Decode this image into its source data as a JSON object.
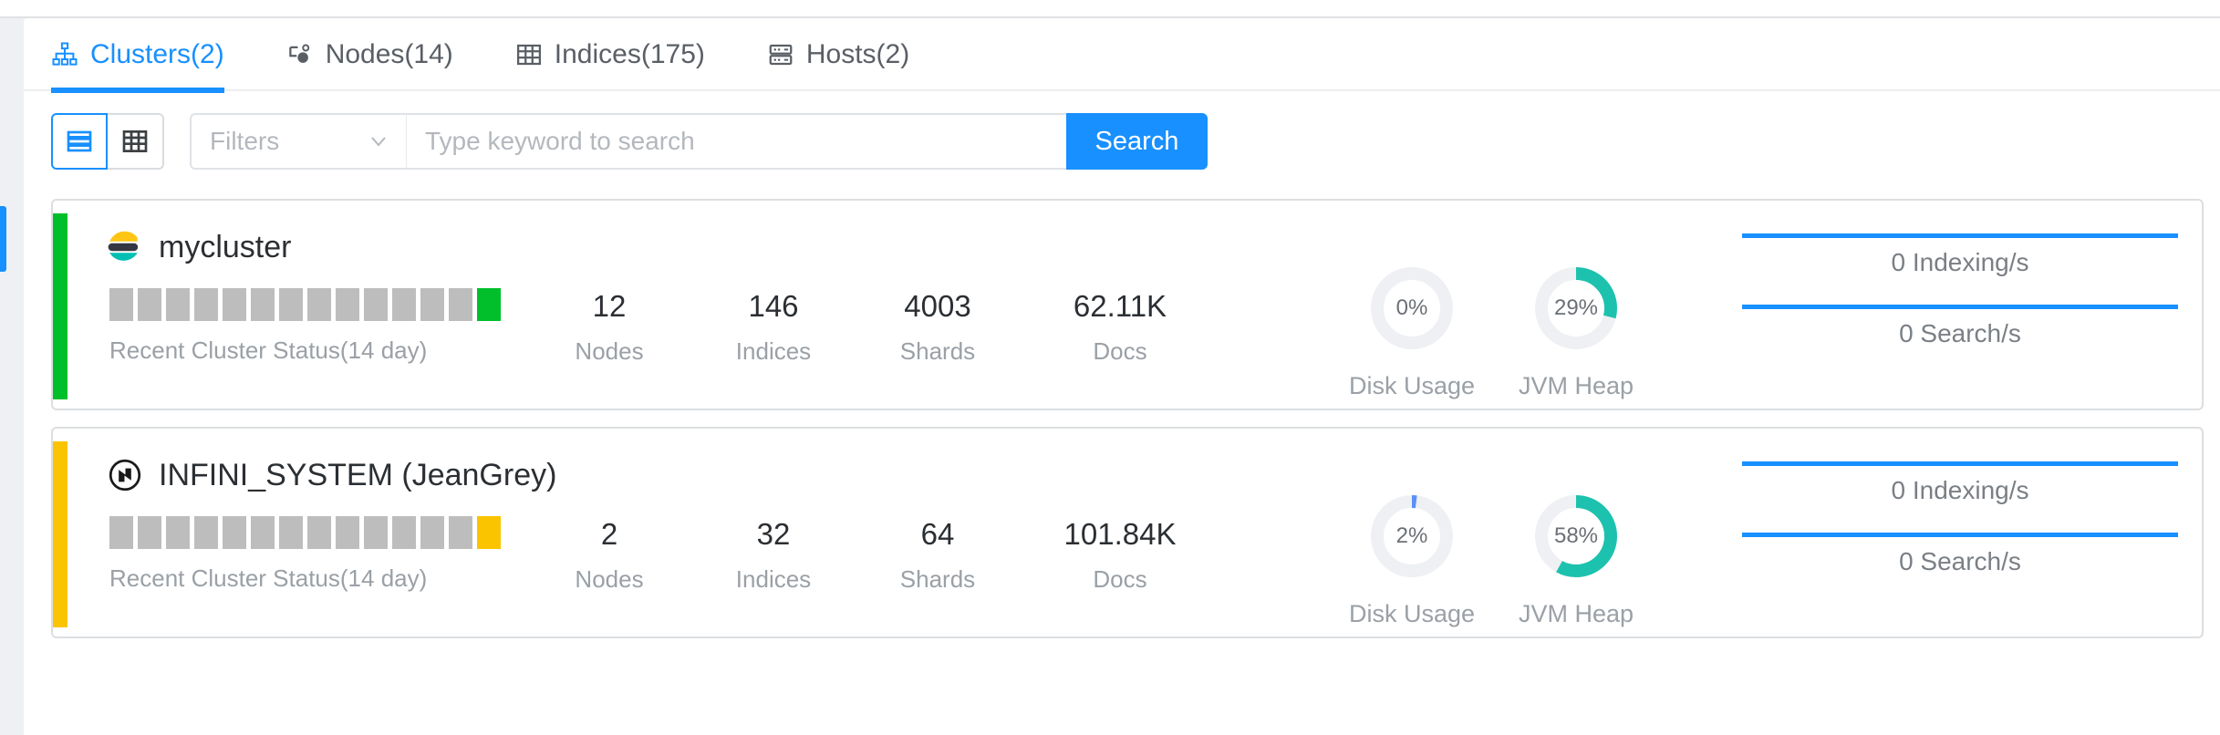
{
  "tabs": [
    {
      "label": "Clusters(2)",
      "icon": "sitemap-icon",
      "active": true
    },
    {
      "label": "Nodes(14)",
      "icon": "node-icon",
      "active": false
    },
    {
      "label": "Indices(175)",
      "icon": "table-icon",
      "active": false
    },
    {
      "label": "Hosts(2)",
      "icon": "server-icon",
      "active": false
    }
  ],
  "toolbar": {
    "list_view_icon": "list-view-icon",
    "table_view_icon": "table-view-icon",
    "filters_label": "Filters",
    "chevron_icon": "chevron-down-icon",
    "search_placeholder": "Type keyword to search",
    "search_value": "",
    "search_button": "Search"
  },
  "colors": {
    "accent": "#1890ff",
    "status_green": "#00bf2a",
    "status_yellow": "#fbc400",
    "bar_gray": "#bdbdbd",
    "donut_teal": "#1cc2ae",
    "donut_track": "#eef0f3",
    "donut_blue": "#5b8ff9"
  },
  "clusters": [
    {
      "name": "mycluster",
      "brand_icon": "elasticsearch-icon",
      "health": "green",
      "status_label": "Recent Cluster Status(14 day)",
      "status_bars": [
        "gray",
        "gray",
        "gray",
        "gray",
        "gray",
        "gray",
        "gray",
        "gray",
        "gray",
        "gray",
        "gray",
        "gray",
        "gray",
        "green"
      ],
      "stats": [
        {
          "value": "12",
          "label": "Nodes"
        },
        {
          "value": "146",
          "label": "Indices"
        },
        {
          "value": "4003",
          "label": "Shards"
        },
        {
          "value": "62.11K",
          "label": "Docs"
        }
      ],
      "gauges": [
        {
          "label": "Disk Usage",
          "value": "0%",
          "percent": 0,
          "color": "#5b8ff9"
        },
        {
          "label": "JVM Heap",
          "value": "29%",
          "percent": 29,
          "color": "#1cc2ae"
        }
      ],
      "sparklines": [
        {
          "label": "0 Indexing/s"
        },
        {
          "label": "0 Search/s"
        }
      ]
    },
    {
      "name": "INFINI_SYSTEM (JeanGrey)",
      "brand_icon": "infini-icon",
      "health": "yellow",
      "status_label": "Recent Cluster Status(14 day)",
      "status_bars": [
        "gray",
        "gray",
        "gray",
        "gray",
        "gray",
        "gray",
        "gray",
        "gray",
        "gray",
        "gray",
        "gray",
        "gray",
        "gray",
        "yellow"
      ],
      "stats": [
        {
          "value": "2",
          "label": "Nodes"
        },
        {
          "value": "32",
          "label": "Indices"
        },
        {
          "value": "64",
          "label": "Shards"
        },
        {
          "value": "101.84K",
          "label": "Docs"
        }
      ],
      "gauges": [
        {
          "label": "Disk Usage",
          "value": "2%",
          "percent": 2,
          "color": "#5b8ff9"
        },
        {
          "label": "JVM Heap",
          "value": "58%",
          "percent": 58,
          "color": "#1cc2ae"
        }
      ],
      "sparklines": [
        {
          "label": "0 Indexing/s"
        },
        {
          "label": "0 Search/s"
        }
      ]
    }
  ]
}
